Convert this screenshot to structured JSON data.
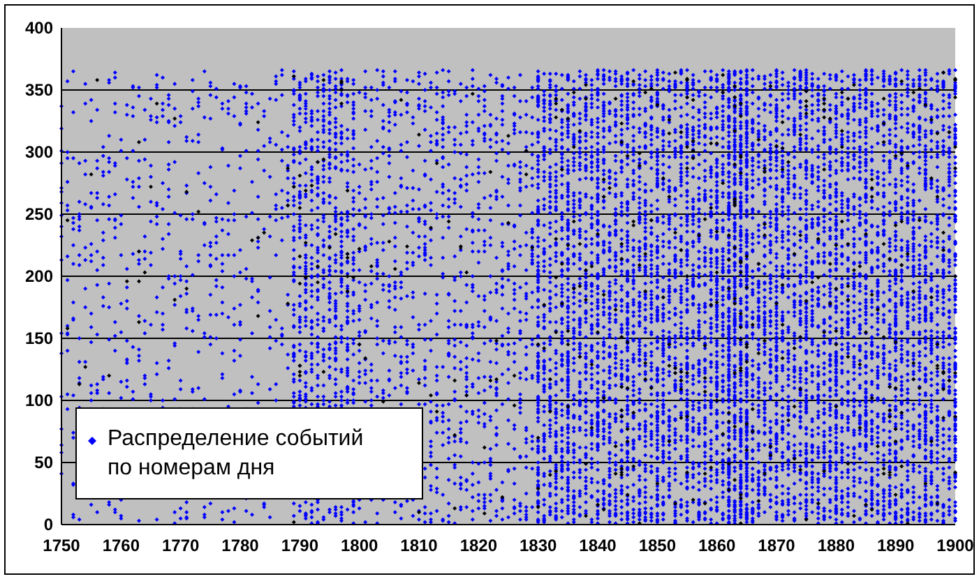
{
  "chart": {
    "y_tick_labels": [
      "400",
      "350",
      "300",
      "250",
      "200",
      "150",
      "100",
      "50",
      "0"
    ],
    "x_tick_labels": [
      "1750",
      "1760",
      "1770",
      "1780",
      "1790",
      "1800",
      "1810",
      "1820",
      "1830",
      "1840",
      "1850",
      "1860",
      "1870",
      "1880",
      "1890",
      "1900"
    ],
    "legend": {
      "label": "Распределение событий\nпо номерам дня",
      "color": "#0000ff"
    }
  }
}
